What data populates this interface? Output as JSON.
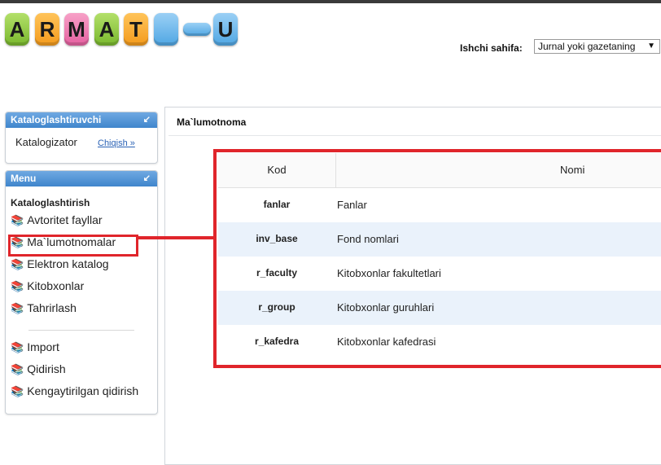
{
  "logo": {
    "letters": [
      "A",
      "R",
      "M",
      "A",
      "T",
      "U"
    ]
  },
  "header": {
    "ishchi_label": "Ishchi sahifa:",
    "ishchi_value": "Jurnal yoki gazetaning",
    "ishchi_arrow": "▼"
  },
  "sidebar": {
    "catalog_panel": {
      "title": "Kataloglashtiruvchi",
      "user": "Katalogizator",
      "logout": "Chiqish »"
    },
    "menu_panel": {
      "title": "Menu",
      "group": "Kataloglashtirish",
      "items": [
        {
          "label": "Avtoritet fayllar",
          "icon": "books-icon"
        },
        {
          "label": "Ma`lumotnomalar",
          "icon": "books-icon"
        },
        {
          "label": "Elektron katalog",
          "icon": "books-icon"
        },
        {
          "label": "Kitobxonlar",
          "icon": "books-icon"
        },
        {
          "label": "Tahrirlash",
          "icon": "books-icon"
        }
      ],
      "items2": [
        {
          "label": "Import",
          "icon": "books-icon"
        },
        {
          "label": "Qidirish",
          "icon": "books-icon"
        },
        {
          "label": "Kengaytirilgan qidirish",
          "icon": "books-icon"
        }
      ]
    }
  },
  "content": {
    "title": "Ma`lumotnoma",
    "table": {
      "headers": [
        "Kod",
        "Nomi"
      ],
      "rows": [
        {
          "kod": "fanlar",
          "nomi": "Fanlar"
        },
        {
          "kod": "inv_base",
          "nomi": "Fond nomlari"
        },
        {
          "kod": "r_faculty",
          "nomi": "Kitobxonlar fakultetlari"
        },
        {
          "kod": "r_group",
          "nomi": "Kitobxonlar guruhlari"
        },
        {
          "kod": "r_kafedra",
          "nomi": "Kitobxonlar kafedrasi"
        }
      ]
    }
  },
  "colors": {
    "panel_header": "#3f85cc",
    "highlight_red": "#e0252b",
    "row_alt": "#eaf2fb"
  }
}
